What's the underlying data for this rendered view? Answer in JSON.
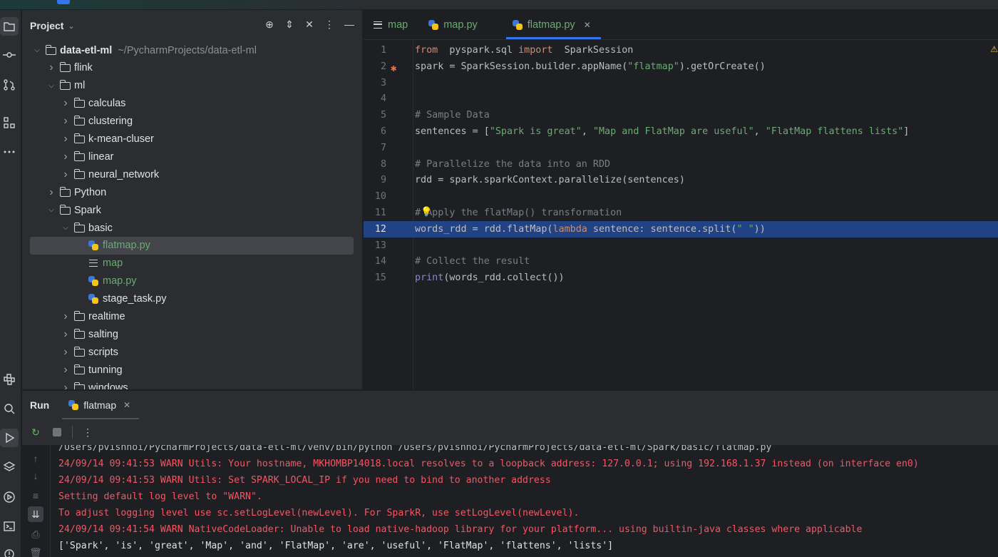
{
  "project_panel": {
    "title": "Project",
    "tree": [
      {
        "label": "data-etl-ml",
        "hint": "~/PycharmProjects/data-etl-ml",
        "type": "folder",
        "depth": 0,
        "expanded": true,
        "bold": true
      },
      {
        "label": "flink",
        "type": "folder",
        "depth": 1,
        "expanded": false
      },
      {
        "label": "ml",
        "type": "folder",
        "depth": 1,
        "expanded": true
      },
      {
        "label": "calculas",
        "type": "folder",
        "depth": 2,
        "expanded": false
      },
      {
        "label": "clustering",
        "type": "folder",
        "depth": 2,
        "expanded": false
      },
      {
        "label": "k-mean-cluser",
        "type": "folder",
        "depth": 2,
        "expanded": false
      },
      {
        "label": "linear",
        "type": "folder",
        "depth": 2,
        "expanded": false
      },
      {
        "label": "neural_network",
        "type": "folder",
        "depth": 2,
        "expanded": false
      },
      {
        "label": "Python",
        "type": "folder",
        "depth": 1,
        "expanded": false
      },
      {
        "label": "Spark",
        "type": "folder",
        "depth": 1,
        "expanded": true
      },
      {
        "label": "basic",
        "type": "folder",
        "depth": 2,
        "expanded": true
      },
      {
        "label": "flatmap.py",
        "type": "python",
        "depth": 3,
        "green": true,
        "selected": true
      },
      {
        "label": "map",
        "type": "text",
        "depth": 3,
        "green": true
      },
      {
        "label": "map.py",
        "type": "python",
        "depth": 3,
        "green": true
      },
      {
        "label": "stage_task.py",
        "type": "python",
        "depth": 3
      },
      {
        "label": "realtime",
        "type": "folder",
        "depth": 2,
        "expanded": false
      },
      {
        "label": "salting",
        "type": "folder",
        "depth": 2,
        "expanded": false
      },
      {
        "label": "scripts",
        "type": "folder",
        "depth": 2,
        "expanded": false
      },
      {
        "label": "tunning",
        "type": "folder",
        "depth": 2,
        "expanded": false
      },
      {
        "label": "windows",
        "type": "folder",
        "depth": 2,
        "expanded": false
      }
    ]
  },
  "editor": {
    "tabs": [
      {
        "label": "map",
        "icon": "text-file-icon",
        "active": false
      },
      {
        "label": "map.py",
        "icon": "python-file-icon",
        "active": false
      },
      {
        "label": "flatmap.py",
        "icon": "python-file-icon",
        "active": true,
        "closable": true
      }
    ],
    "highlighted_line": 12,
    "lines": [
      {
        "n": "1",
        "html": "<span class='kw'>from</span>  pyspark.sql <span class='kw'>import</span>  SparkSession"
      },
      {
        "n": "2",
        "html": "spark = SparkSession.builder.appName(<span class='str'>\"flatmap\"</span>).getOrCreate()"
      },
      {
        "n": "3",
        "html": ""
      },
      {
        "n": "4",
        "html": ""
      },
      {
        "n": "5",
        "html": "<span class='cmt'># Sample Data</span>"
      },
      {
        "n": "6",
        "html": "sentences = [<span class='str'>\"Spark is great\"</span>, <span class='str'>\"Map and FlatMap are useful\"</span>, <span class='str'>\"FlatMap flattens lists\"</span>]"
      },
      {
        "n": "7",
        "html": ""
      },
      {
        "n": "8",
        "html": "<span class='cmt'># Parallelize the data into an RDD</span>"
      },
      {
        "n": "9",
        "html": "rdd = spark.sparkContext.parallelize(sentences)"
      },
      {
        "n": "10",
        "html": ""
      },
      {
        "n": "11",
        "html": "<span class='cmt'># Apply the flatMap() transformation</span>"
      },
      {
        "n": "12",
        "html": "words_rdd = rdd.flatMap(<span class='kw'>lambda</span> sentence: sentence.split(<span class='str'>\" \"</span>))"
      },
      {
        "n": "13",
        "html": ""
      },
      {
        "n": "14",
        "html": "<span class='cmt'># Collect the result</span>"
      },
      {
        "n": "15",
        "html": "<span class='bi'>print</span>(words_rdd.collect())"
      }
    ]
  },
  "run_panel": {
    "title": "Run",
    "tab_label": "flatmap",
    "console": [
      {
        "text": "/Users/pvishnoi/PycharmProjects/data-etl-ml/venv/bin/python /Users/pvishnoi/PycharmProjects/data-etl-ml/Spark/basic/flatmap.py",
        "kind": "out"
      },
      {
        "text": "24/09/14 09:41:53 WARN Utils: Your hostname, MKHOMBP14018.local resolves to a loopback address: 127.0.0.1; using 192.168.1.37 instead (on interface en0)",
        "kind": "err"
      },
      {
        "text": "24/09/14 09:41:53 WARN Utils: Set SPARK_LOCAL_IP if you need to bind to another address",
        "kind": "err"
      },
      {
        "text": "Setting default log level to \"WARN\".",
        "kind": "err"
      },
      {
        "text": "To adjust logging level use sc.setLogLevel(newLevel). For SparkR, use setLogLevel(newLevel).",
        "kind": "err"
      },
      {
        "text": "24/09/14 09:41:54 WARN NativeCodeLoader: Unable to load native-hadoop library for your platform... using builtin-java classes where applicable",
        "kind": "err"
      },
      {
        "text": "['Spark', 'is', 'great', 'Map', 'and', 'FlatMap', 'are', 'useful', 'FlatMap', 'flattens', 'lists']",
        "kind": "out"
      }
    ]
  }
}
